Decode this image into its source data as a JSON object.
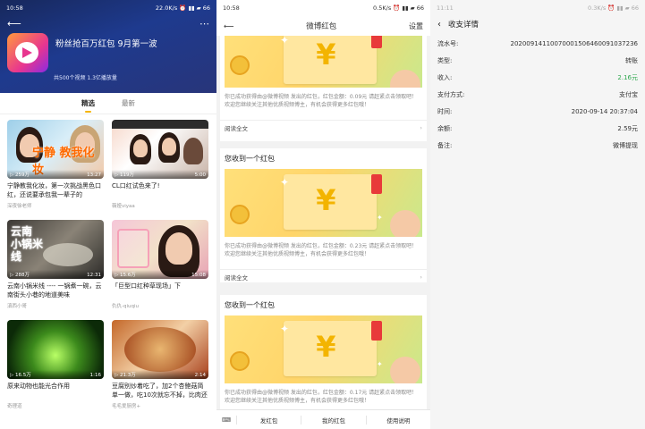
{
  "panel1": {
    "status": {
      "time": "10:58",
      "right": "22.0K/s ⏰ ▮▮ ▰ 66"
    },
    "menu_icon": "more-icon",
    "title": "粉丝抢百万红包 9月第一波",
    "stats": "共500个视频   1.3亿播放量",
    "tabs": [
      "精选",
      "最新"
    ],
    "cards": [
      {
        "plays": "▷ 259万",
        "duration": "13:27",
        "title": "宁静教我化妆，第一次挑战黑色口红，还说要承包我一辈子的",
        "author": "深夜徐老师",
        "thumb_text": "宁静 教我化妆"
      },
      {
        "plays": "▷ 119万",
        "duration": "5:00",
        "title": "CL口红试色来了!",
        "author": "薇娅viyaa",
        "thumb_text": ""
      },
      {
        "plays": "▷ 288万",
        "duration": "12:31",
        "title": "云南小锅米线 ---- 一锅煮一碗，云南街头小巷的地道美味",
        "author": "滇西小哥",
        "thumb_text": "云南 小锅米线"
      },
      {
        "plays": "▷ 15.6万",
        "duration": "15:08",
        "title": "「巨型口红种草现场」下",
        "author": "仇仇-qiuqiu",
        "thumb_text": ""
      },
      {
        "plays": "▷ 16.5万",
        "duration": "1:16",
        "title": "原来动物也能光合作用",
        "author": "奇理道",
        "thumb_text": ""
      },
      {
        "plays": "▷ 21.3万",
        "duration": "2:14",
        "title": "豆腐别炒着吃了，加2个杏鲍菇简单一做，吃10次就忘不掉，比肉还",
        "author": "毛毛爱厨房+",
        "thumb_text": ""
      }
    ]
  },
  "panel2": {
    "status": {
      "time": "10:58",
      "right": "0.5K/s ⏰ ▮▮ ▰ 66"
    },
    "title": "微博红包",
    "settings": "设置",
    "card_header": "您收到一个红包",
    "cards": [
      {
        "text": "你已成功获得由@微博视频 发出的红包，红包金额：0.09元 请赶紧点击领取吧！欢迎您继续关注其他优质视频博主，有机会获得更多红包哦！",
        "link": "阅读全文"
      },
      {
        "text": "你已成功获得由@微博视频 发出的红包，红包金额：0.23元 请赶紧点击领取吧！欢迎您继续关注其他优质视频博主，有机会获得更多红包哦！",
        "link": "阅读全文"
      },
      {
        "text": "你已成功获得由@微博视频 发出的红包，红包金额：0.17元 请赶紧点击领取吧！欢迎您继续关注其他优质视频博主，有机会获得更多红包哦！",
        "link": "阅读全文"
      }
    ],
    "bottom": {
      "keyboard_icon": "keyboard-icon",
      "items": [
        "发红包",
        "我的红包",
        "使用说明"
      ]
    }
  },
  "panel3": {
    "status": {
      "time": "11:11",
      "right": "0.3K/s ⏰ ▮▮ ▰ 66"
    },
    "title": "收支详情",
    "rows": [
      {
        "label": "流水号:",
        "value": "20200914110070001506460091037236"
      },
      {
        "label": "类型:",
        "value": "转账"
      },
      {
        "label": "收入:",
        "value": "2.16元"
      },
      {
        "label": "支付方式:",
        "value": "支付宝"
      },
      {
        "label": "时间:",
        "value": "2020-09-14 20:37:04"
      },
      {
        "label": "余额:",
        "value": "2.59元"
      },
      {
        "label": "备注:",
        "value": "微博提现"
      }
    ],
    "income_color": "#2fa84f"
  }
}
